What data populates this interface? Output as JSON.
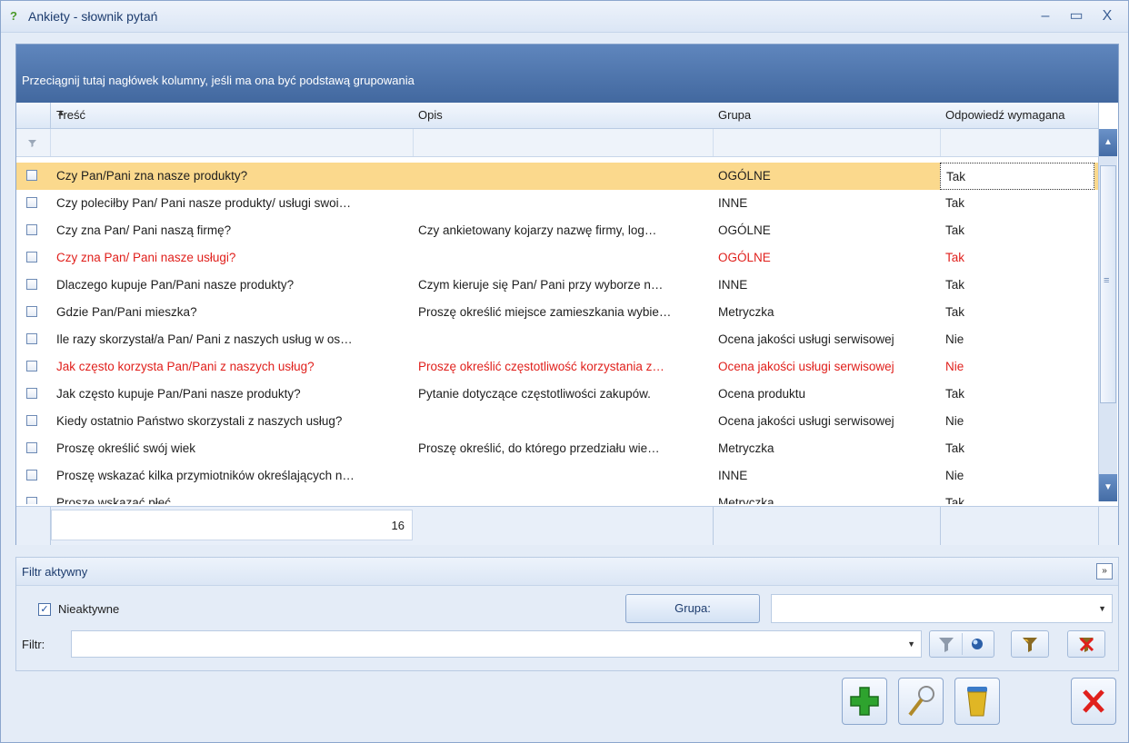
{
  "window": {
    "title": "Ankiety - słownik pytań"
  },
  "grid": {
    "group_panel_text": "Przeciągnij tutaj nagłówek kolumny, jeśli ma ona być podstawą grupowania",
    "columns": [
      "Treść",
      "Opis",
      "Grupa",
      "Odpowiedź wymagana"
    ],
    "rows": [
      {
        "tresc": "Czy Pan/Pani zna nasze produkty?",
        "opis": "",
        "grupa": "OGÓLNE",
        "odp": "Tak"
      },
      {
        "tresc": "Czy poleciłby Pan/ Pani nasze produkty/ usługi swoi…",
        "opis": "",
        "grupa": "INNE",
        "odp": "Tak"
      },
      {
        "tresc": "Czy zna Pan/ Pani naszą firmę?",
        "opis": "Czy ankietowany kojarzy nazwę firmy, log…",
        "grupa": "OGÓLNE",
        "odp": "Tak"
      },
      {
        "tresc": "Czy zna Pan/ Pani nasze usługi?",
        "opis": "",
        "grupa": "OGÓLNE",
        "odp": "Tak"
      },
      {
        "tresc": "Dlaczego kupuje Pan/Pani nasze produkty?",
        "opis": "Czym kieruje się Pan/ Pani przy wyborze n…",
        "grupa": "INNE",
        "odp": "Tak"
      },
      {
        "tresc": "Gdzie Pan/Pani mieszka?",
        "opis": "Proszę określić miejsce zamieszkania wybie…",
        "grupa": "Metryczka",
        "odp": "Tak"
      },
      {
        "tresc": "Ile razy skorzystał/a Pan/ Pani z naszych usług w os…",
        "opis": "",
        "grupa": "Ocena jakości usługi serwisowej",
        "odp": "Nie"
      },
      {
        "tresc": "Jak często korzysta Pan/Pani z naszych usług?",
        "opis": "Proszę określić częstotliwość korzystania z…",
        "grupa": "Ocena jakości usługi serwisowej",
        "odp": "Nie"
      },
      {
        "tresc": "Jak często kupuje Pan/Pani nasze produkty?",
        "opis": "Pytanie dotyczące częstotliwości zakupów.",
        "grupa": "Ocena produktu",
        "odp": "Tak"
      },
      {
        "tresc": "Kiedy ostatnio Państwo skorzystali z naszych usług?",
        "opis": "",
        "grupa": "Ocena jakości usługi serwisowej",
        "odp": "Nie"
      },
      {
        "tresc": "Proszę określić swój wiek",
        "opis": "Proszę określić, do którego przedziału wie…",
        "grupa": "Metryczka",
        "odp": "Tak"
      },
      {
        "tresc": "Proszę wskazać kilka przymiotników określających n…",
        "opis": "",
        "grupa": "INNE",
        "odp": "Nie"
      },
      {
        "tresc": "Proszę wskazać płeć",
        "opis": "",
        "grupa": "Metryczka",
        "odp": "Tak"
      }
    ],
    "red_rows": [
      3,
      7
    ],
    "count": "16"
  },
  "filter": {
    "header": "Filtr aktywny",
    "inactive_label": "Nieaktywne",
    "inactive_checked": true,
    "grupa_button": "Grupa:",
    "filtr_label": "Filtr:",
    "filtr_value": "",
    "grupa_value": ""
  },
  "colors": {
    "accent": "#42689f",
    "selection": "#fbd98d",
    "red_text": "#e0201c"
  }
}
